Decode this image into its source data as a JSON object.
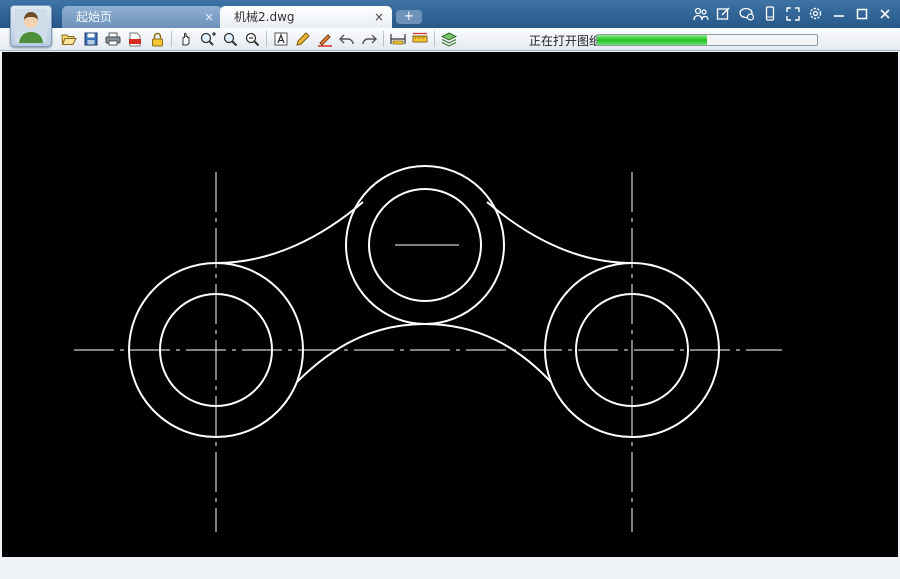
{
  "tabs": [
    {
      "label": "起始页",
      "close": "×",
      "active": false
    },
    {
      "label": "机械2.dwg",
      "close": "×",
      "active": true
    }
  ],
  "new_tab_label": "+",
  "window_icons": [
    "users-icon",
    "edit-icon",
    "cloud-icon",
    "phone-icon",
    "fullscreen-icon",
    "settings-icon",
    "minimize-icon",
    "maximize-icon",
    "close-icon"
  ],
  "toolbar_icons": [
    "open-icon",
    "save-icon",
    "print-icon",
    "pdf-icon",
    "lock-icon",
    "pan-icon",
    "zoom-in-icon",
    "zoom-window-icon",
    "zoom-extent-icon",
    "text-icon",
    "pencil-icon",
    "markup-icon",
    "undo-icon",
    "redo-icon",
    "measure-icon",
    "dimension-icon",
    "layers-icon"
  ],
  "status": {
    "label": "正在打开图纸",
    "progress": 0.5
  },
  "colors": {
    "canvas": "#000000",
    "drawing": "#ffffff",
    "title_bar": "#2f6398",
    "progress": "#2ecc40"
  }
}
